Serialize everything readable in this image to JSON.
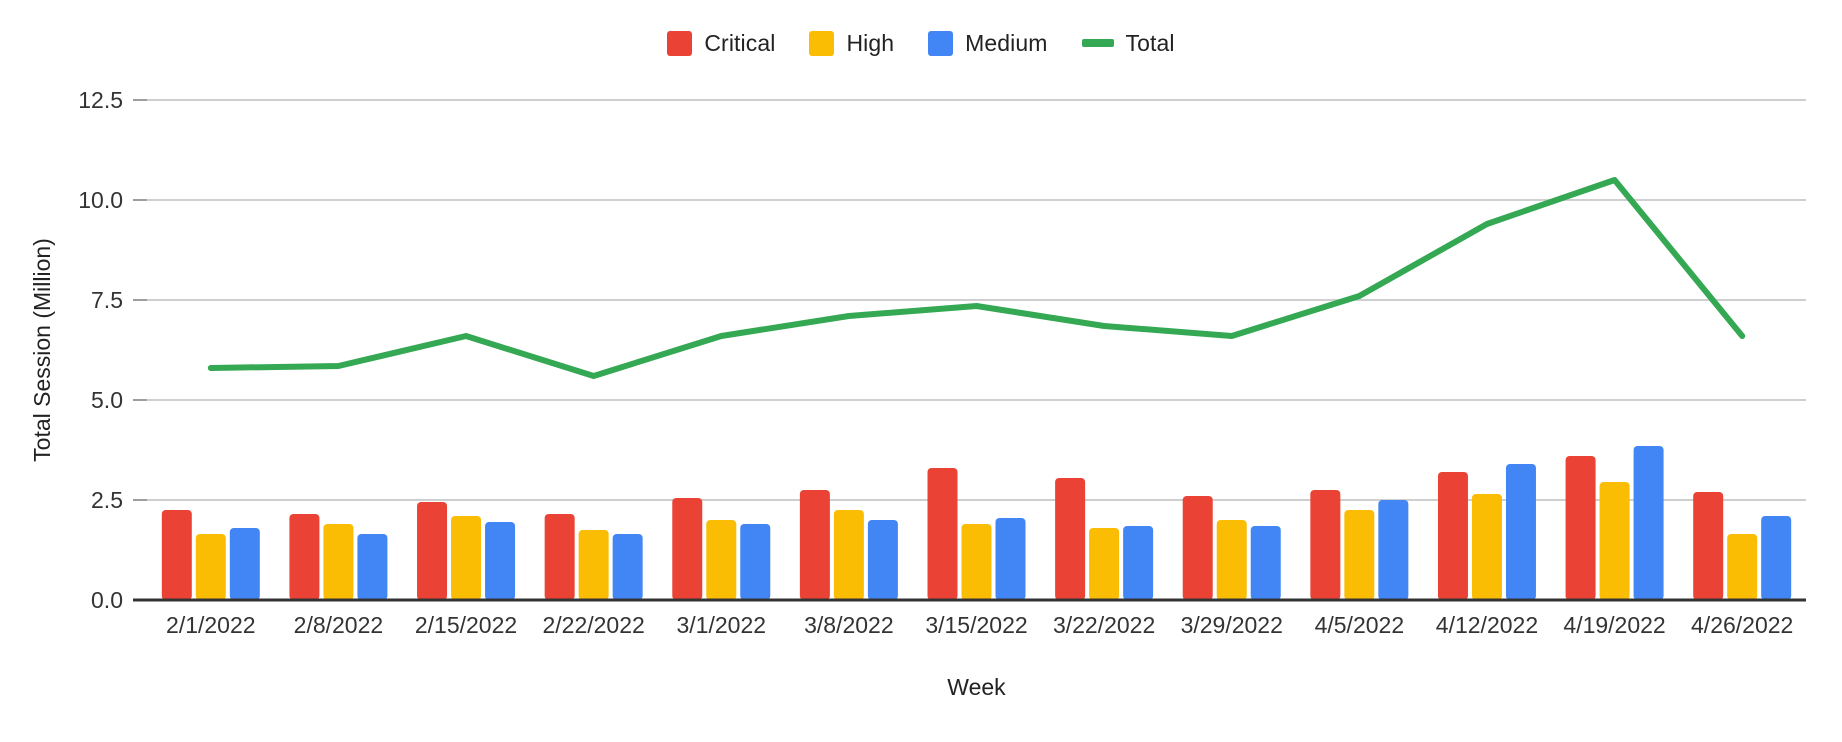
{
  "chart_data": {
    "type": "bar",
    "title": "",
    "subtitle": "",
    "xlabel": "Week",
    "ylabel": "Total Session (Million)",
    "ylim": [
      0,
      13.3
    ],
    "yticks": [
      "0.0",
      "2.5",
      "5.0",
      "7.5",
      "10.0",
      "12.5"
    ],
    "ytick_values": [
      0,
      2.5,
      5.0,
      7.5,
      10.0,
      12.5
    ],
    "grid": true,
    "legend_position": "top-center",
    "categories": [
      "2/1/2022",
      "2/8/2022",
      "2/15/2022",
      "2/22/2022",
      "3/1/2022",
      "3/8/2022",
      "3/15/2022",
      "3/22/2022",
      "3/29/2022",
      "4/5/2022",
      "4/12/2022",
      "4/19/2022",
      "4/26/2022"
    ],
    "series": [
      {
        "name": "Critical",
        "type": "bar",
        "color": "#ea4335",
        "values": [
          2.25,
          2.15,
          2.45,
          2.15,
          2.55,
          2.75,
          3.3,
          3.05,
          2.6,
          2.75,
          3.2,
          3.6,
          2.7
        ]
      },
      {
        "name": "High",
        "type": "bar",
        "color": "#fbbc04",
        "values": [
          1.65,
          1.9,
          2.1,
          1.75,
          2.0,
          2.25,
          1.9,
          1.8,
          2.0,
          2.25,
          2.65,
          2.95,
          1.65
        ]
      },
      {
        "name": "Medium",
        "type": "bar",
        "color": "#4285f4",
        "values": [
          1.8,
          1.65,
          1.95,
          1.65,
          1.9,
          2.0,
          2.05,
          1.85,
          1.85,
          2.5,
          3.4,
          3.85,
          2.1
        ]
      },
      {
        "name": "Total",
        "type": "line",
        "color": "#34a853",
        "values": [
          5.8,
          5.85,
          6.6,
          5.6,
          6.6,
          7.1,
          7.35,
          6.85,
          6.6,
          7.6,
          9.4,
          10.5,
          6.6
        ]
      }
    ]
  },
  "legend": {
    "items": [
      {
        "label": "Critical",
        "color": "#ea4335",
        "marker": "square",
        "icon": "legend-square-icon"
      },
      {
        "label": "High",
        "color": "#fbbc04",
        "marker": "square",
        "icon": "legend-square-icon"
      },
      {
        "label": "Medium",
        "color": "#4285f4",
        "marker": "square",
        "icon": "legend-square-icon"
      },
      {
        "label": "Total",
        "color": "#34a853",
        "marker": "line",
        "icon": "legend-line-icon"
      }
    ]
  },
  "axes": {
    "y_title": "Total Session (Million)",
    "x_title": "Week"
  },
  "colors": {
    "critical": "#ea4335",
    "high": "#fbbc04",
    "medium": "#4285f4",
    "total": "#34a853",
    "grid": "#cfcfcf",
    "axis": "#333333",
    "background": "#ffffff"
  }
}
